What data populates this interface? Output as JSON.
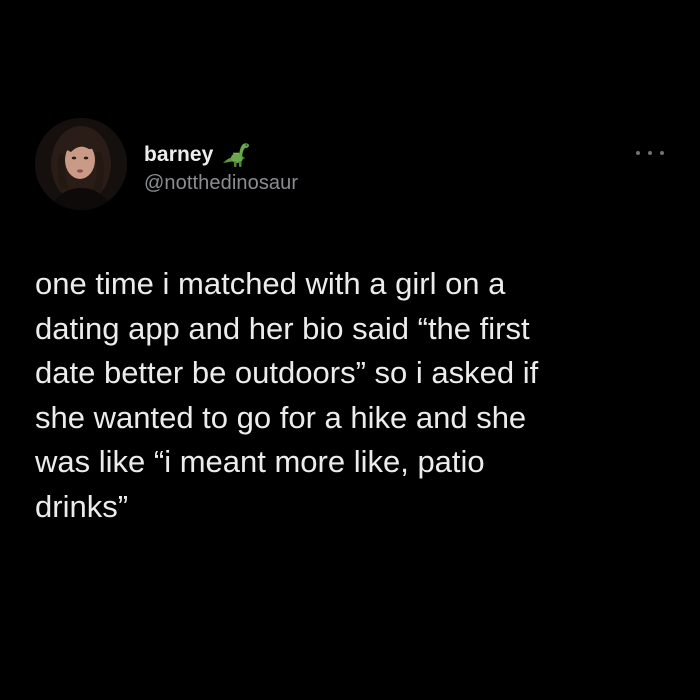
{
  "user": {
    "display_name": "barney",
    "handle": "@notthedinosaur",
    "name_emoji": "dinosaur-icon"
  },
  "menu": {
    "icon": "more-options-icon"
  },
  "tweet": {
    "lines": [
      "one time i matched with a girl on a",
      "dating app and her bio said “the first",
      "date better be outdoors” so i asked if",
      "she wanted to go for a hike and she",
      "was like “i meant more like, patio",
      "drinks”"
    ]
  },
  "colors": {
    "background": "#000000",
    "text": "#ececed",
    "secondary_text": "#8b8d91",
    "dino_green": "#6aa84f"
  }
}
